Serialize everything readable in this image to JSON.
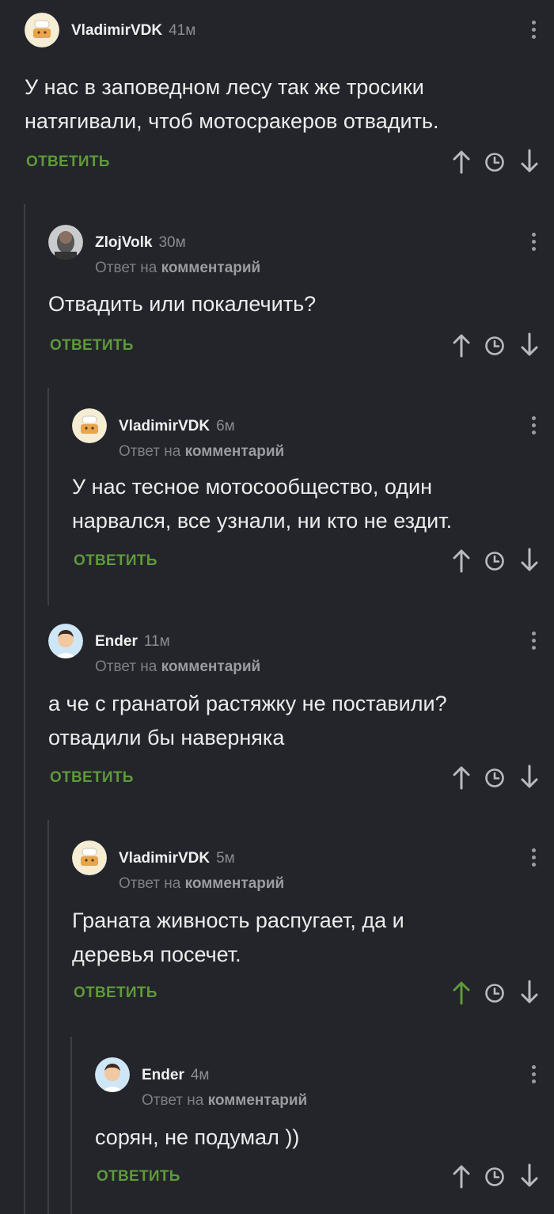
{
  "labels": {
    "reply_button": "ОТВЕТИТЬ",
    "reply_to_prefix": "Ответ на",
    "reply_to_target": "комментарий"
  },
  "colors": {
    "background": "#23252a",
    "accent_green": "#5e9a3a",
    "thread_line": "#3c3f45"
  },
  "comments": [
    {
      "author": "VladimirVDK",
      "time": "41м",
      "is_reply": false,
      "avatar": "dog-emoji-avatar",
      "text": "У нас в заповедном лесу так же тросики\nнатягивали, чтоб мотосракеров отвадить.",
      "upvoted": false
    },
    {
      "author": "ZlojVolk",
      "time": "30м",
      "is_reply": true,
      "avatar": "photo-avatar",
      "text": "Отвадить или покалечить?",
      "upvoted": false
    },
    {
      "author": "VladimirVDK",
      "time": "6м",
      "is_reply": true,
      "avatar": "dog-emoji-avatar",
      "text": "У нас тесное мотосообщество, один\nнарвался, все узнали, ни кто не ездит.",
      "upvoted": false
    },
    {
      "author": "Ender",
      "time": "11м",
      "is_reply": true,
      "avatar": "man-avatar",
      "text": "а че с гранатой растяжку не поставили?\nотвадили бы наверняка",
      "upvoted": false
    },
    {
      "author": "VladimirVDK",
      "time": "5м",
      "is_reply": true,
      "avatar": "dog-emoji-avatar",
      "text": "Граната живность распугает, да и\nдеревья посечет.",
      "upvoted": true
    },
    {
      "author": "Ender",
      "time": "4м",
      "is_reply": true,
      "avatar": "man-avatar",
      "text": "сорян, не подумал ))",
      "upvoted": false
    }
  ]
}
